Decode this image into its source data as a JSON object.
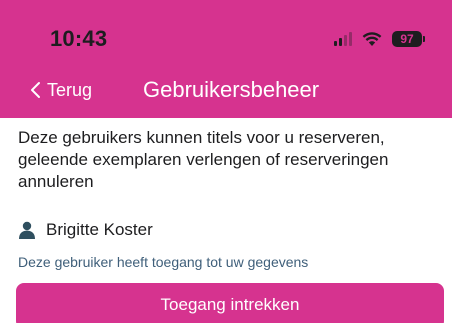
{
  "status_bar": {
    "time": "10:43",
    "battery_level": "97",
    "icons": [
      "signal-icon",
      "wifi-icon",
      "battery-icon"
    ]
  },
  "nav": {
    "back_label": "Terug",
    "title": "Gebruikersbeheer"
  },
  "content": {
    "description": "Deze gebruikers kunnen titels voor u reserveren, geleende exemplaren verlengen of reserveringen annuleren",
    "user": {
      "name": "Brigitte Koster",
      "icon": "person-icon",
      "access_note": "Deze gebruiker heeft toegang tot uw gegevens"
    },
    "revoke_button_label": "Toegang intrekken"
  },
  "colors": {
    "brand": "#d6338f",
    "text": "#1d1d1f",
    "note_text": "#3f5f7a",
    "icon": "#2f4f5f"
  }
}
